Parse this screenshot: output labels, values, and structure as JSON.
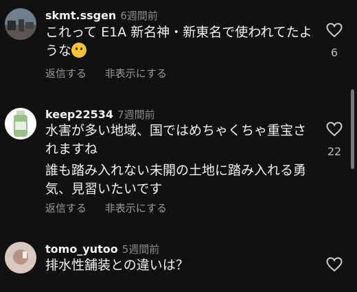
{
  "comments": [
    {
      "username": "skmt.ssgen",
      "time": "6週間前",
      "text_lines": [
        "これって E1A 新名神・新東名で使われてたよ",
        "うな"
      ],
      "likes": "6",
      "reply_label": "返信する",
      "hide_label": "非表示にする",
      "emoji": "thinking-face"
    },
    {
      "username": "keep22534",
      "time": "7週間前",
      "text_lines": [
        "水害が多い地域、国ではめちゃくちゃ重宝さ",
        "れますね",
        "誰も踏み入れない未開の土地に踏み入れる勇",
        "気、見習いたいです"
      ],
      "likes": "22",
      "reply_label": "返信する",
      "hide_label": "非表示にする"
    },
    {
      "username": "tomo_yutoo",
      "time": "5週間前",
      "text_lines": [
        "排水性舗装との違いは？"
      ]
    }
  ],
  "icons": {
    "like": "heart-outline-icon"
  }
}
